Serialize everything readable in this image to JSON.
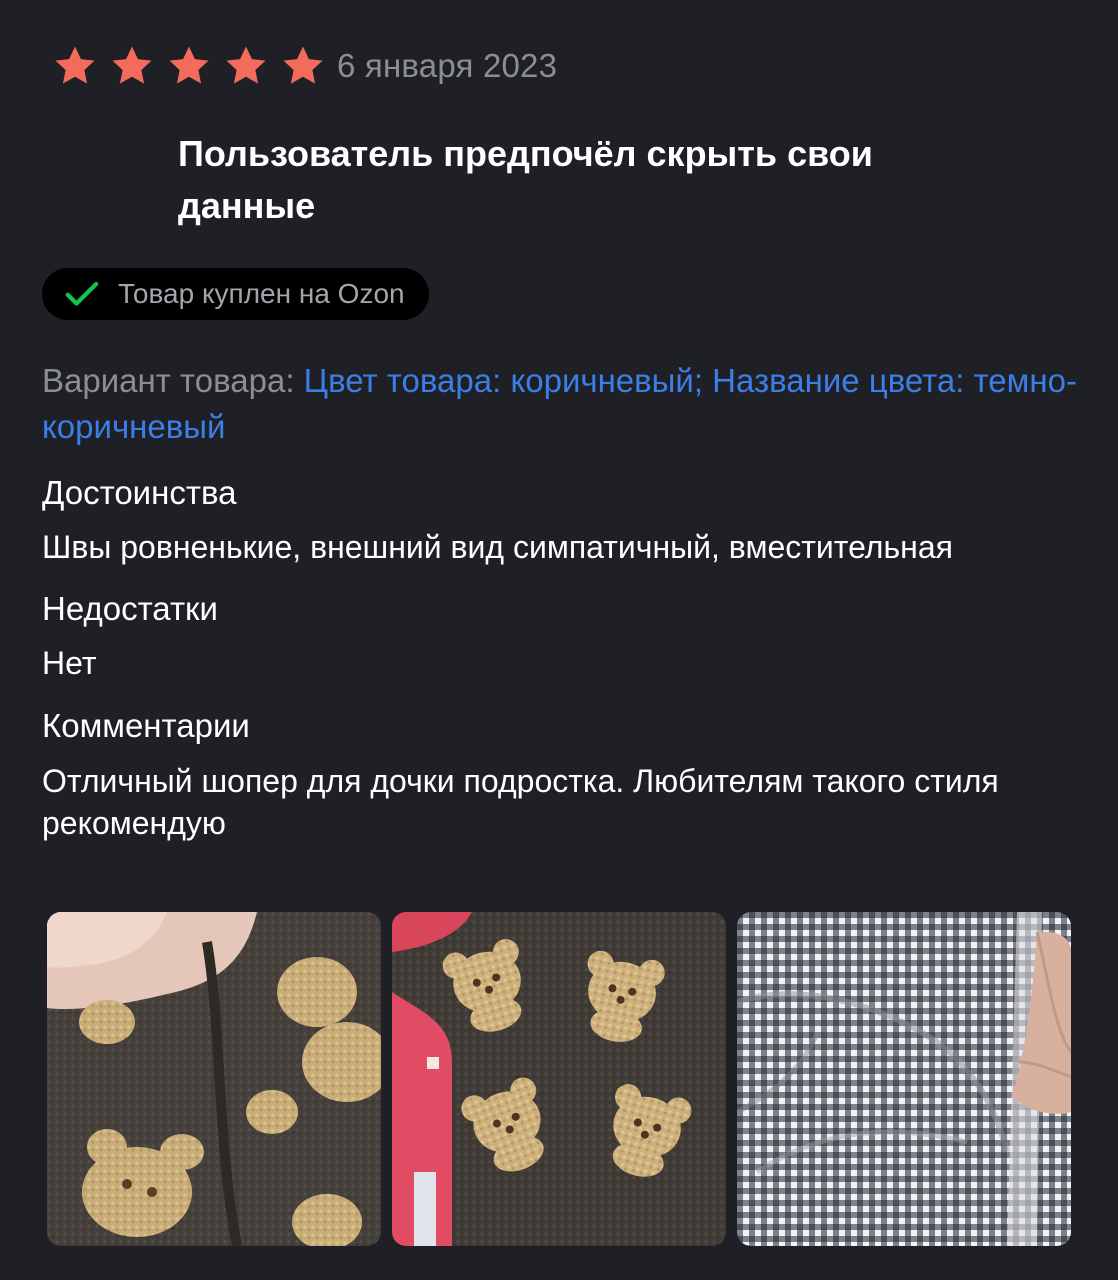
{
  "review": {
    "rating": 5,
    "rating_max": 5,
    "star_color": "#f26b5b",
    "date": "6 января 2023",
    "author": "Пользователь предпочёл скрыть свои данные",
    "badge": {
      "icon": "check-icon",
      "text": "Товар куплен на Ozon",
      "icon_color": "#10c44c"
    },
    "variant": {
      "label": "Вариант товара: ",
      "value": "Цвет товара: коричневый; Название цвета: темно-коричневый",
      "value_color": "#3b7ee5"
    },
    "pros": {
      "title": "Достоинства",
      "text": "Швы ровненькие, внешний вид симпатичный, вместительная"
    },
    "cons": {
      "title": "Недостатки",
      "text": "Нет"
    },
    "comment": {
      "title": "Комментарии",
      "text": "Отличный шопер для дочки подростка. Любителям такого стиля рекомендую"
    },
    "photos": [
      {
        "name": "review-photo-1",
        "subject": "brown teddy-bear fleece fabric with fingers"
      },
      {
        "name": "review-photo-2",
        "subject": "brown teddy-bear fleece bag with pink item"
      },
      {
        "name": "review-photo-3",
        "subject": "black and white gingham lining with hand"
      }
    ]
  }
}
